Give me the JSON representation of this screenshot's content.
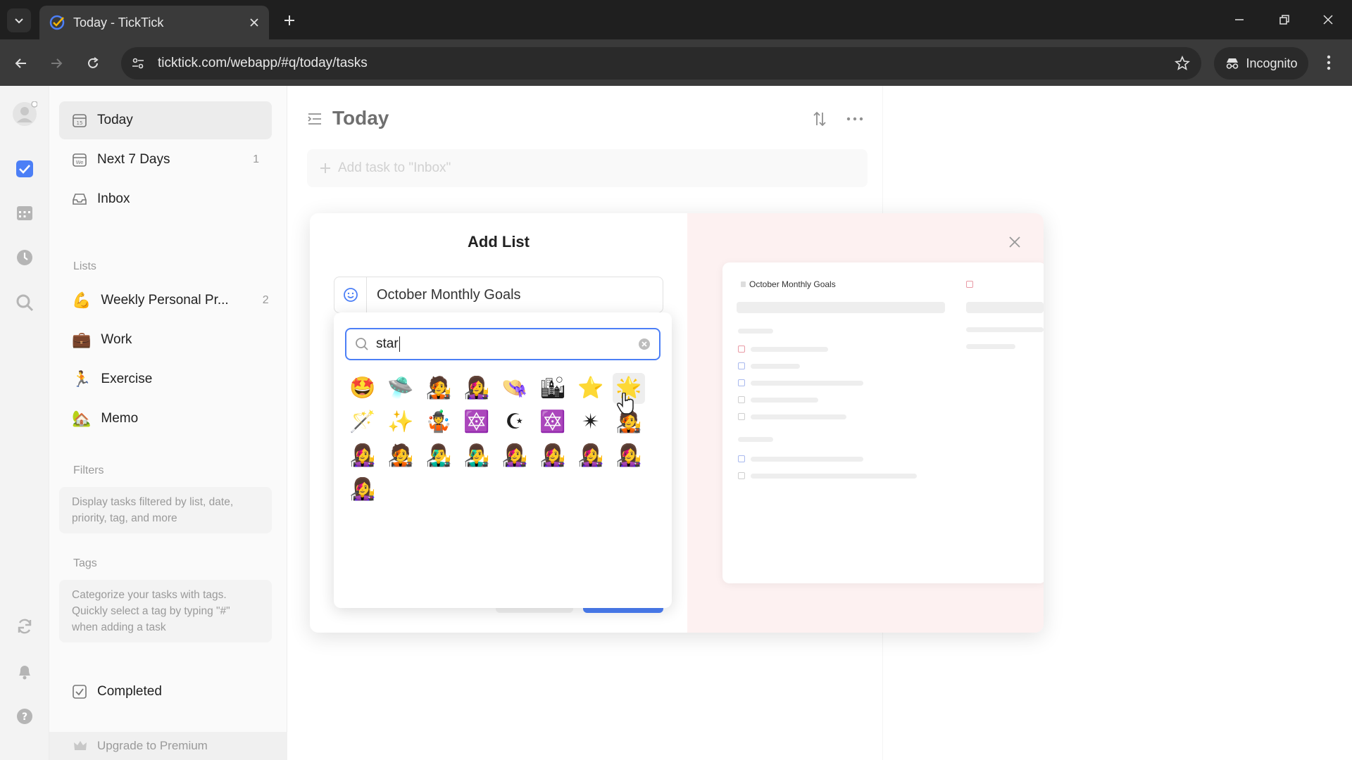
{
  "browser": {
    "tab_title": "Today - TickTick",
    "url": "ticktick.com/webapp/#q/today/tasks",
    "incognito_label": "Incognito"
  },
  "sidebar": {
    "smart_lists": [
      {
        "label": "Today",
        "count": "",
        "icon": "calendar-day-icon"
      },
      {
        "label": "Next 7 Days",
        "count": "1",
        "icon": "calendar-week-icon"
      },
      {
        "label": "Inbox",
        "count": "",
        "icon": "inbox-icon"
      }
    ],
    "lists_header": "Lists",
    "lists": [
      {
        "label": "Weekly Personal Pr...",
        "count": "2",
        "icon": "flexed-biceps-icon",
        "glyph": "💪"
      },
      {
        "label": "Work",
        "count": "",
        "icon": "briefcase-icon",
        "glyph": "💼"
      },
      {
        "label": "Exercise",
        "count": "",
        "icon": "running-person-icon",
        "glyph": "🏃"
      },
      {
        "label": "Memo",
        "count": "",
        "icon": "house-icon",
        "glyph": "🏡"
      }
    ],
    "filters_header": "Filters",
    "filters_hint": "Display tasks filtered by list, date, priority, tag, and more",
    "tags_header": "Tags",
    "tags_hint": "Categorize your tasks with tags. Quickly select a tag by typing \"#\" when adding a task",
    "completed_label": "Completed",
    "upgrade_label": "Upgrade to Premium"
  },
  "main": {
    "title": "Today",
    "add_task_placeholder": "Add task to \"Inbox\""
  },
  "modal": {
    "title": "Add List",
    "list_name": "October Monthly Goals",
    "preview_title": "October Monthly Goals"
  },
  "emoji_picker": {
    "search_value": "star",
    "results": [
      "🤩",
      "🛸",
      "🧑‍🎤",
      "👩‍🎤",
      "👒",
      "🏙",
      "⭐",
      "🌟",
      "🪄",
      "✨",
      "🤹",
      "🔯",
      "☪",
      "🔯",
      "✴",
      "🧑‍🎤",
      "👩‍🎤",
      "🧑‍🎤",
      "👨‍🎤",
      "👨‍🎤",
      "👩‍🎤",
      "👩‍🎤",
      "👩‍🎤",
      "👩‍🎤",
      "👩‍🎤"
    ]
  },
  "colors": {
    "accent": "#4c7ff6",
    "modal_preview_bg": "#fdf1f1",
    "list_dot": "#f7cb1e"
  }
}
